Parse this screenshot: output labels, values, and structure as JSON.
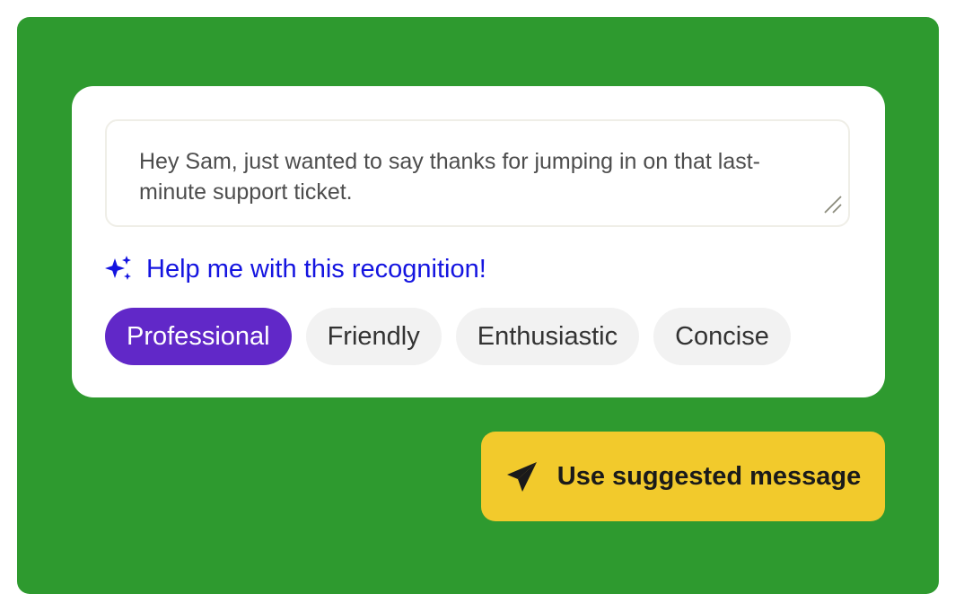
{
  "message": {
    "text": "Hey Sam, just wanted to say thanks for jumping in on that last-minute support ticket."
  },
  "assist": {
    "label": "Help me with this recognition!",
    "icon": "sparkles-icon",
    "color": "#1414e0"
  },
  "tones": [
    {
      "label": "Professional",
      "selected": true
    },
    {
      "label": "Friendly",
      "selected": false
    },
    {
      "label": "Enthusiastic",
      "selected": false
    },
    {
      "label": "Concise",
      "selected": false
    }
  ],
  "cta": {
    "label": "Use suggested message",
    "icon": "send-icon",
    "color": "#f2ca2c"
  },
  "colors": {
    "background": "#2e9a2f",
    "selected_chip": "#6128c8",
    "chip": "#f2f2f2"
  }
}
